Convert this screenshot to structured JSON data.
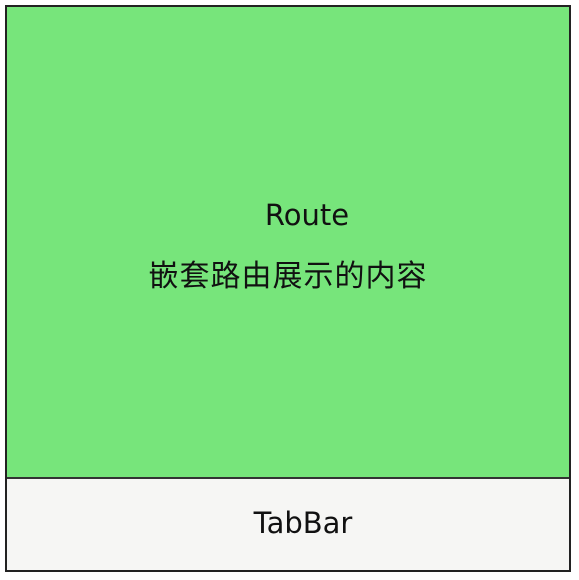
{
  "route": {
    "title": "Route",
    "description": "嵌套路由展示的内容"
  },
  "tabbar": {
    "label": "TabBar"
  },
  "colors": {
    "route_fill": "#77e57b",
    "tabbar_fill": "#f6f6f4",
    "border": "#222222",
    "text": "#111111"
  }
}
